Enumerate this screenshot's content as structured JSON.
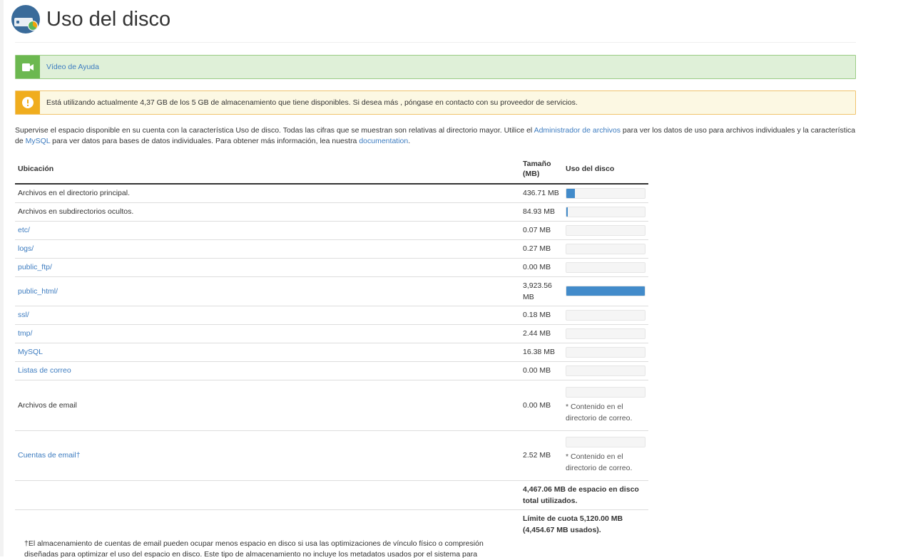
{
  "header": {
    "title": "Uso del disco"
  },
  "help": {
    "label": "Vídeo de Ayuda"
  },
  "warning": {
    "text": "Está utilizando actualmente 4,37 GB de los 5 GB de almacenamiento que tiene disponibles. Si desea más , póngase en contacto con su proveedor de servicios."
  },
  "intro": {
    "p1": "Supervise el espacio disponible en su cuenta con la característica Uso de disco. Todas las cifras que se muestran son relativas al directorio mayor. Utilice el ",
    "link1": "Administrador de archivos",
    "p2": " para ver los datos de uso para archivos individuales y la característica de ",
    "link2": "MySQL",
    "p3": " para ver datos para bases de datos individuales. Para obtener más información, lea nuestra ",
    "link3": "documentation",
    "p4": "."
  },
  "table": {
    "col_location": "Ubicación",
    "col_size": "Tamaño (MB)",
    "col_usage": "Uso del disco",
    "rows": [
      {
        "location": "Archivos en el directorio principal.",
        "link": false,
        "size": "436.71 MB",
        "usage": 0.111
      },
      {
        "location": "Archivos en subdirectorios ocultos.",
        "link": false,
        "size": "84.93 MB",
        "usage": 0.022
      },
      {
        "location": "etc/",
        "link": true,
        "size": "0.07 MB",
        "usage": 0
      },
      {
        "location": "logs/",
        "link": true,
        "size": "0.27 MB",
        "usage": 0
      },
      {
        "location": "public_ftp/",
        "link": true,
        "size": "0.00 MB",
        "usage": 0
      },
      {
        "location": "public_html/",
        "link": true,
        "size": "3,923.56 MB",
        "usage": 1.0
      },
      {
        "location": "ssl/",
        "link": true,
        "size": "0.18 MB",
        "usage": 0
      },
      {
        "location": "tmp/",
        "link": true,
        "size": "2.44 MB",
        "usage": 0
      },
      {
        "location": "MySQL",
        "link": true,
        "size": "16.38 MB",
        "usage": 0
      },
      {
        "location": "Listas de correo",
        "link": true,
        "size": "0.00 MB",
        "usage": 0
      },
      {
        "location": "Archivos de email",
        "link": false,
        "size": "0.00 MB",
        "usage": 0,
        "note": "* Contenido en el directorio de correo."
      },
      {
        "location": "Cuentas de email†",
        "link": true,
        "size": "2.52 MB",
        "usage": 0,
        "note": "* Contenido en el directorio de correo."
      }
    ],
    "total_used": "4,467.06 MB de espacio en disco total utilizados.",
    "quota": "Límite de cuota 5,120.00 MB (4,454.67 MB usados)."
  },
  "footnote": "†El almacenamiento de cuentas de email pueden ocupar menos espacio en disco si usa las optimizaciones de vínculo físico o compresión diseñadas para optimizar el uso del espacio en disco. Este tipo de almacenamiento no incluye los metadatos usados por el sistema para",
  "colors": {
    "bar_fill": "#428bca",
    "link": "#3d7cc0"
  }
}
